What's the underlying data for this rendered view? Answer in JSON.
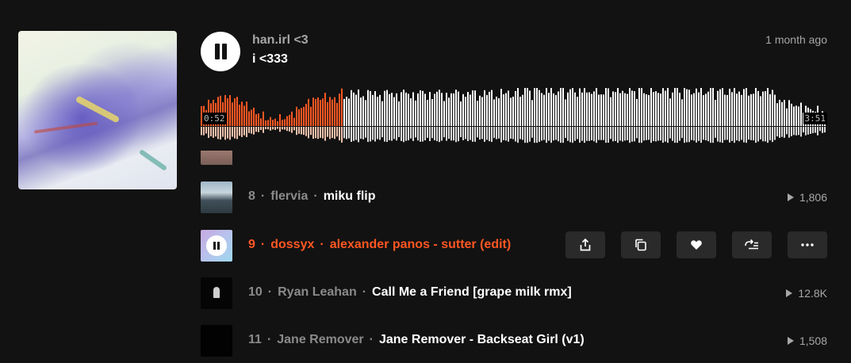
{
  "now_playing": {
    "artist": "han.irl <3",
    "title": "i <333",
    "posted": "1 month ago",
    "elapsed": "0:52",
    "duration": "3:51",
    "progress": 0.225,
    "icon": "pause-icon"
  },
  "colors": {
    "accent": "#ff5722",
    "played_reflection": "#f1c2ad",
    "unplayed": "#ffffff",
    "background": "#121212"
  },
  "tracks": [
    {
      "number": "8",
      "artist": "flervia",
      "title": "miku flip",
      "plays": "1,806"
    },
    {
      "number": "9",
      "artist": "dossyx",
      "title": "alexander panos - sutter (edit)",
      "active": true
    },
    {
      "number": "10",
      "artist": "Ryan Leahan",
      "title": "Call Me a Friend [grape milk rmx]",
      "plays": "12.8K"
    },
    {
      "number": "11",
      "artist": "Jane Remover",
      "title": "Jane Remover - Backseat Girl (v1)",
      "plays": "1,508"
    }
  ],
  "separator": "·",
  "actions": [
    "share-icon",
    "copy-icon",
    "heart-icon",
    "add-to-next-up-icon",
    "more-icon"
  ]
}
